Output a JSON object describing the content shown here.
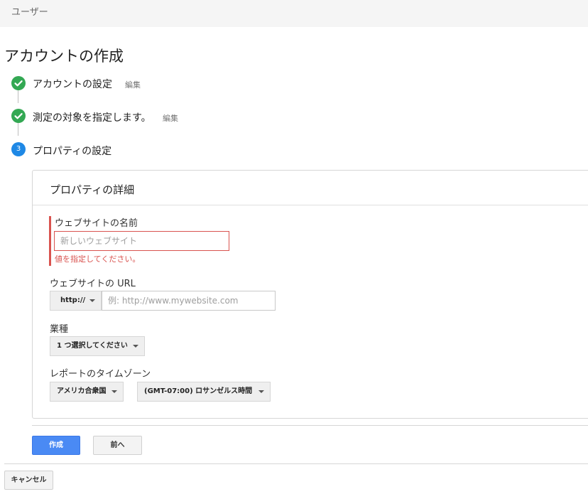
{
  "breadcrumb": "ユーザー",
  "page_title": "アカウントの作成",
  "steps": [
    {
      "label": "アカウントの設定",
      "edit": "編集",
      "state": "done"
    },
    {
      "label": "測定の対象を指定します。",
      "edit": "編集",
      "state": "done"
    },
    {
      "label": "プロパティの設定",
      "number": "3",
      "state": "current"
    }
  ],
  "panel": {
    "title": "プロパティの詳細",
    "site_name": {
      "label": "ウェブサイトの名前",
      "placeholder": "新しいウェブサイト",
      "value": "",
      "error": "値を指定してください。"
    },
    "site_url": {
      "label": "ウェブサイトの URL",
      "protocol": "http://",
      "placeholder": "例: http://www.mywebsite.com",
      "value": ""
    },
    "industry": {
      "label": "業種",
      "selected": "1 つ選択してください"
    },
    "timezone": {
      "label": "レポートのタイムゾーン",
      "country": "アメリカ合衆国",
      "zone": "(GMT-07:00) ロサンゼルス時間"
    }
  },
  "buttons": {
    "create": "作成",
    "previous": "前へ",
    "cancel": "キャンセル"
  },
  "colors": {
    "done": "#33a853",
    "current": "#1e88e5",
    "error": "#d9534f",
    "primary": "#4a8af4"
  }
}
